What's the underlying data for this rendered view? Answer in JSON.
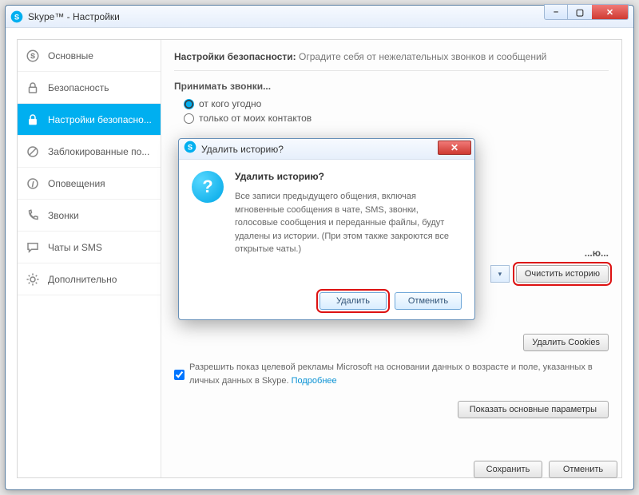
{
  "window": {
    "title": "Skype™ - Настройки"
  },
  "sidebar": {
    "items": [
      {
        "label": "Основные"
      },
      {
        "label": "Безопасность"
      },
      {
        "label": "Настройки безопасно..."
      },
      {
        "label": "Заблокированные по..."
      },
      {
        "label": "Оповещения"
      },
      {
        "label": "Звонки"
      },
      {
        "label": "Чаты и SMS"
      },
      {
        "label": "Дополнительно"
      }
    ]
  },
  "main": {
    "heading": "Настройки безопасности:",
    "subtitle": " Оградите себя от нежелательных звонков и сообщений",
    "accept_calls_label": "Принимать звонки...",
    "radio_anyone": "от кого угодно",
    "radio_contacts": "только от моих контактов",
    "history_label": "...ю...",
    "clear_history_btn": "Очистить историю",
    "delete_cookies_btn": "Удалить Cookies",
    "ads_checkbox": "Разрешить показ целевой рекламы Microsoft на основании данных о возрасте и поле, указанных в личных данных в Skype. ",
    "ads_link": "Подробнее",
    "show_basic_btn": "Показать основные параметры"
  },
  "dialog": {
    "title": "Удалить историю?",
    "heading": "Удалить историю?",
    "body": "Все записи предыдущего общения, включая мгновенные сообщения в чате, SMS, звонки, голосовые сообщения и переданные файлы, будут удалены из истории. (При этом также закроются все открытые чаты.)",
    "delete_btn": "Удалить",
    "cancel_btn": "Отменить"
  },
  "footer": {
    "save": "Сохранить",
    "cancel": "Отменить"
  }
}
